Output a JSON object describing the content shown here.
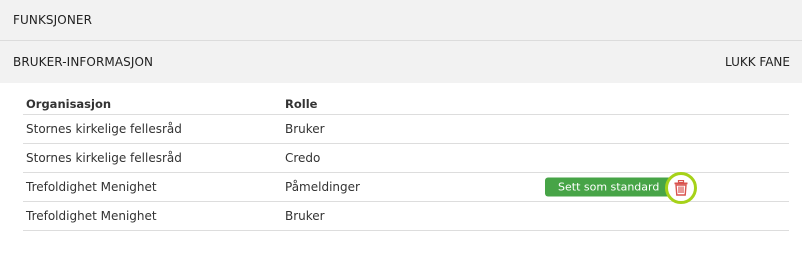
{
  "sections": {
    "functions_title": "FUNKSJONER",
    "user_info_title": "BRUKER-INFORMASJON",
    "close_tab_label": "LUKK FANE"
  },
  "table": {
    "headers": {
      "organisation": "Organisasjon",
      "role": "Rolle"
    },
    "rows": [
      {
        "organisation": "Stornes kirkelige fellesråd",
        "role": "Bruker"
      },
      {
        "organisation": "Stornes kirkelige fellesråd",
        "role": "Credo"
      },
      {
        "organisation": "Trefoldighet Menighet",
        "role": "Påmeldinger",
        "action_label": "Sett som standard",
        "delete_icon": "trash-icon"
      },
      {
        "organisation": "Trefoldighet Menighet",
        "role": "Bruker"
      }
    ]
  },
  "colors": {
    "header_bg": "#f2f2f2",
    "button_green": "#47a447",
    "trash_red": "#d9534f",
    "highlight_ring": "#a6d219"
  }
}
